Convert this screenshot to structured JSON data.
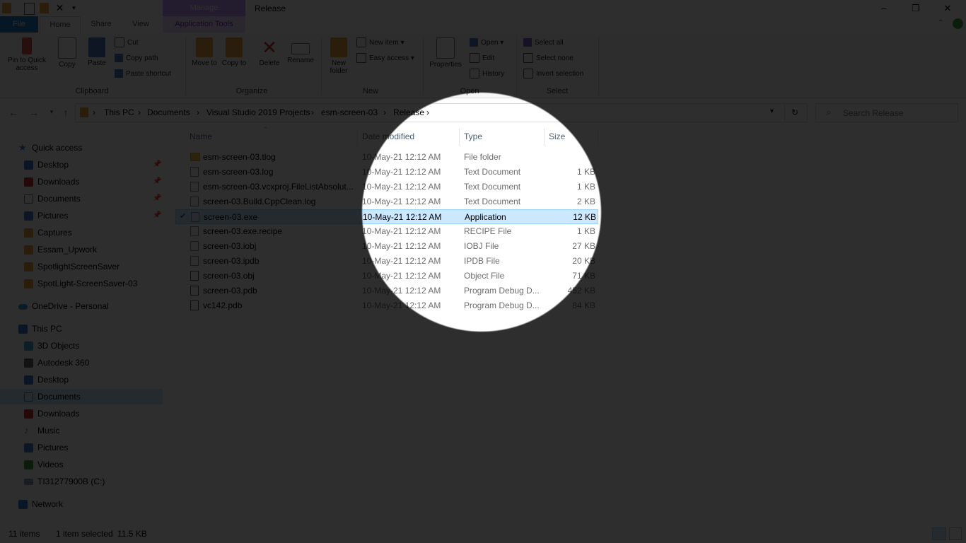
{
  "window": {
    "title": "Release",
    "manage_tab": "Manage",
    "controls": {
      "minimize": "–",
      "restore": "❐",
      "close": "✕"
    }
  },
  "ribbon": {
    "tabs": [
      "File",
      "Home",
      "Share",
      "View",
      "Application Tools"
    ],
    "groups": {
      "clipboard": {
        "label": "Clipboard",
        "pin": "Pin to Quick access",
        "copy": "Copy",
        "paste": "Paste",
        "cut": "Cut",
        "copy_path": "Copy path",
        "paste_shortcut": "Paste shortcut"
      },
      "organize": {
        "label": "Organize",
        "move_to": "Move to",
        "copy_to": "Copy to",
        "delete": "Delete",
        "rename": "Rename"
      },
      "new": {
        "label": "New",
        "new_folder": "New folder",
        "new_item": "New item",
        "easy_access": "Easy access"
      },
      "open": {
        "label": "Open",
        "properties": "Properties",
        "open": "Open",
        "edit": "Edit",
        "history": "History"
      },
      "select": {
        "label": "Select",
        "select_all": "Select all",
        "select_none": "Select none",
        "invert": "Invert selection"
      }
    }
  },
  "address": {
    "crumbs": [
      "This PC",
      "Documents",
      "Visual Studio 2019 Projects",
      "esm-screen-03",
      "Release"
    ],
    "search_placeholder": "Search Release"
  },
  "nav": {
    "quick_access": "Quick access",
    "quick_items": [
      "Desktop",
      "Downloads",
      "Documents",
      "Pictures",
      "Captures",
      "Essam_Upwork",
      "SpotlightScreenSaver",
      "SpotLight-ScreenSaver-03"
    ],
    "onedrive": "OneDrive - Personal",
    "this_pc": "This PC",
    "pc_items": [
      "3D Objects",
      "Autodesk 360",
      "Desktop",
      "Documents",
      "Downloads",
      "Music",
      "Pictures",
      "Videos",
      "TI31277900B (C:)"
    ],
    "network": "Network"
  },
  "columns": {
    "name": "Name",
    "date": "Date modified",
    "type": "Type",
    "size": "Size"
  },
  "files": [
    {
      "name": "esm-screen-03.tlog",
      "date": "10-May-21 12:12 AM",
      "type": "File folder",
      "size": ""
    },
    {
      "name": "esm-screen-03.log",
      "date": "10-May-21 12:12 AM",
      "type": "Text Document",
      "size": "1 KB"
    },
    {
      "name": "esm-screen-03.vcxproj.FileListAbsolut...",
      "date": "10-May-21 12:12 AM",
      "type": "Text Document",
      "size": "1 KB"
    },
    {
      "name": "screen-03.Build.CppClean.log",
      "date": "10-May-21 12:12 AM",
      "type": "Text Document",
      "size": "2 KB"
    },
    {
      "name": "screen-03.exe",
      "date": "10-May-21 12:12 AM",
      "type": "Application",
      "size": "12 KB"
    },
    {
      "name": "screen-03.exe.recipe",
      "date": "10-May-21 12:12 AM",
      "type": "RECIPE File",
      "size": "1 KB"
    },
    {
      "name": "screen-03.iobj",
      "date": "10-May-21 12:12 AM",
      "type": "IOBJ File",
      "size": "27 KB"
    },
    {
      "name": "screen-03.ipdb",
      "date": "10-May-21 12:12 AM",
      "type": "IPDB File",
      "size": "20 KB"
    },
    {
      "name": "screen-03.obj",
      "date": "10-May-21 12:12 AM",
      "type": "Object File",
      "size": "71 KB"
    },
    {
      "name": "screen-03.pdb",
      "date": "10-May-21 12:12 AM",
      "type": "Program Debug D...",
      "size": "452 KB"
    },
    {
      "name": "vc142.pdb",
      "date": "10-May-21 12:12 AM",
      "type": "Program Debug D...",
      "size": "84 KB"
    }
  ],
  "status": {
    "items": "11 items",
    "selected": "1 item selected",
    "selected_size": "11.5 KB"
  },
  "colors": {
    "file_tab": "#1979ca",
    "manage_tab": "#c09aff",
    "selection": "#cce8ff",
    "overlay": "#000000"
  }
}
